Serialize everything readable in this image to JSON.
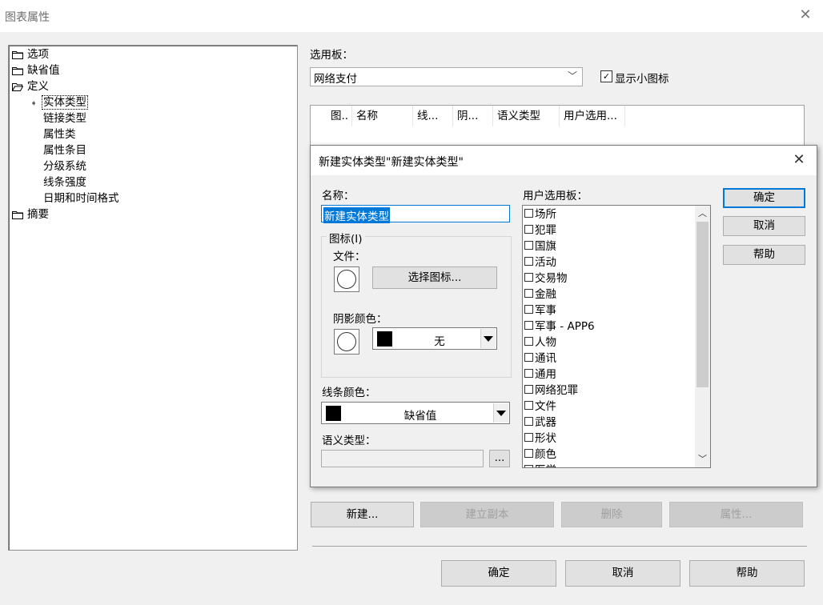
{
  "window": {
    "title": "图表属性",
    "close_glyph": "✕"
  },
  "tree": {
    "items": [
      {
        "label": "选项",
        "icon": "folder-icon"
      },
      {
        "label": "缺省值",
        "icon": "folder-icon"
      },
      {
        "label": "定义",
        "icon": "folder-open-icon"
      },
      {
        "label": "实体类型",
        "icon": "arrow-icon",
        "selected": true
      },
      {
        "label": "链接类型"
      },
      {
        "label": "属性类"
      },
      {
        "label": "属性条目"
      },
      {
        "label": "分级系统"
      },
      {
        "label": "线条强度"
      },
      {
        "label": "日期和时间格式"
      },
      {
        "label": "摘要",
        "icon": "folder-icon"
      }
    ]
  },
  "palette": {
    "label": "选用板：",
    "value": "网络支付",
    "show_small_icons_label": "显示小图标",
    "show_small_icons_checked": true
  },
  "listview": {
    "columns": [
      "图..",
      "名称",
      "线...",
      "阴...",
      "语义类型",
      "用户选用..."
    ]
  },
  "bottom_buttons": {
    "new": "新建...",
    "copy": "建立副本",
    "delete": "删除",
    "properties": "属性..."
  },
  "footer_buttons": {
    "ok": "确定",
    "cancel": "取消",
    "help": "帮助"
  },
  "dialog": {
    "title": "新建实体类型\"新建实体类型\"",
    "name_label": "名称：",
    "name_value": "新建实体类型",
    "icon_group_label": "图标(I)",
    "file_label": "文件：",
    "choose_icon_button": "选择图标...",
    "shadow_color_label": "阴影颜色：",
    "shadow_color_value": "无",
    "line_color_label": "线条颜色：",
    "line_color_value": "缺省值",
    "semantic_type_label": "语义类型：",
    "semantic_browse": "...",
    "user_palettes_label": "用户选用板：",
    "user_palettes": [
      "场所",
      "犯罪",
      "国旗",
      "活动",
      "交易物",
      "金融",
      "军事",
      "军事 - APP6",
      "人物",
      "通讯",
      "通用",
      "网络犯罪",
      "文件",
      "武器",
      "形状",
      "颜色",
      "医学"
    ],
    "ok": "确定",
    "cancel": "取消",
    "help": "帮助"
  },
  "colors": {
    "accent": "#0078d7",
    "window_bg": "#f0f0f0"
  }
}
